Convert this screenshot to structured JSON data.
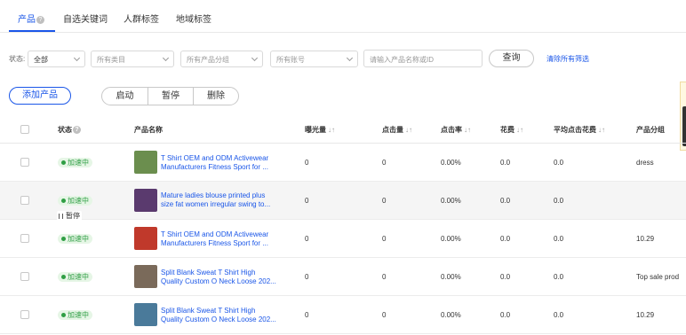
{
  "tabs": [
    {
      "label": "产品",
      "help": "?"
    },
    {
      "label": "自选关键词"
    },
    {
      "label": "人群标签"
    },
    {
      "label": "地域标签"
    }
  ],
  "filters": {
    "status_label": "状态:",
    "status_value": "全部",
    "category_placeholder": "所有类目",
    "group_placeholder": "所有产品分组",
    "account_placeholder": "所有账号",
    "search_placeholder": "请输入产品名称或ID",
    "query_label": "查询",
    "clear_label": "清除所有筛选"
  },
  "actions": {
    "add_label": "添加产品",
    "start_label": "启动",
    "pause_label": "暂停",
    "delete_label": "删除"
  },
  "table": {
    "headers": {
      "status": "状态",
      "status_help": "?",
      "name": "产品名称",
      "impressions": "曝光量",
      "clicks": "点击量",
      "ctr": "点击率",
      "cost": "花费",
      "avg_cpc": "平均点击花费",
      "group": "产品分组"
    },
    "sort_symbol": "↓↑",
    "rows": [
      {
        "status": "加速中",
        "name1": "T Shirt OEM and ODM Activewear",
        "name2": "Manufacturers Fitness Sport for ...",
        "impressions": "0",
        "clicks": "0",
        "ctr": "0.00%",
        "cost": "0.0",
        "avg_cpc": "0.0",
        "group": "dress",
        "thumb_color": "#6b8e4e"
      },
      {
        "status": "加速中",
        "name1": "Mature ladies blouse printed plus",
        "name2": "size fat women irregular swing to...",
        "impressions": "0",
        "clicks": "0",
        "ctr": "0.00%",
        "cost": "0.0",
        "avg_cpc": "0.0",
        "group": "",
        "thumb_color": "#5a3a6e"
      },
      {
        "status": "加速中",
        "name1": "T Shirt OEM and ODM Activewear",
        "name2": "Manufacturers Fitness Sport for ...",
        "impressions": "0",
        "clicks": "0",
        "ctr": "0.00%",
        "cost": "0.0",
        "avg_cpc": "0.0",
        "group": "10.29",
        "thumb_color": "#c0392b"
      },
      {
        "status": "加速中",
        "name1": "Split Blank Sweat T Shirt High",
        "name2": "Quality Custom O Neck Loose 202...",
        "impressions": "0",
        "clicks": "0",
        "ctr": "0.00%",
        "cost": "0.0",
        "avg_cpc": "0.0",
        "group": "Top sale prod",
        "thumb_color": "#7a6a5a"
      },
      {
        "status": "加速中",
        "name1": "Split Blank Sweat T Shirt High",
        "name2": "Quality Custom O Neck Loose 202...",
        "impressions": "0",
        "clicks": "0",
        "ctr": "0.00%",
        "cost": "0.0",
        "avg_cpc": "0.0",
        "group": "10.29",
        "thumb_color": "#4a7a9a"
      }
    ]
  },
  "hover_tooltip": {
    "label": "暂停"
  },
  "colors": {
    "primary": "#1a56e8",
    "success": "#2f9e44",
    "success_bg": "#e6f6e6"
  }
}
